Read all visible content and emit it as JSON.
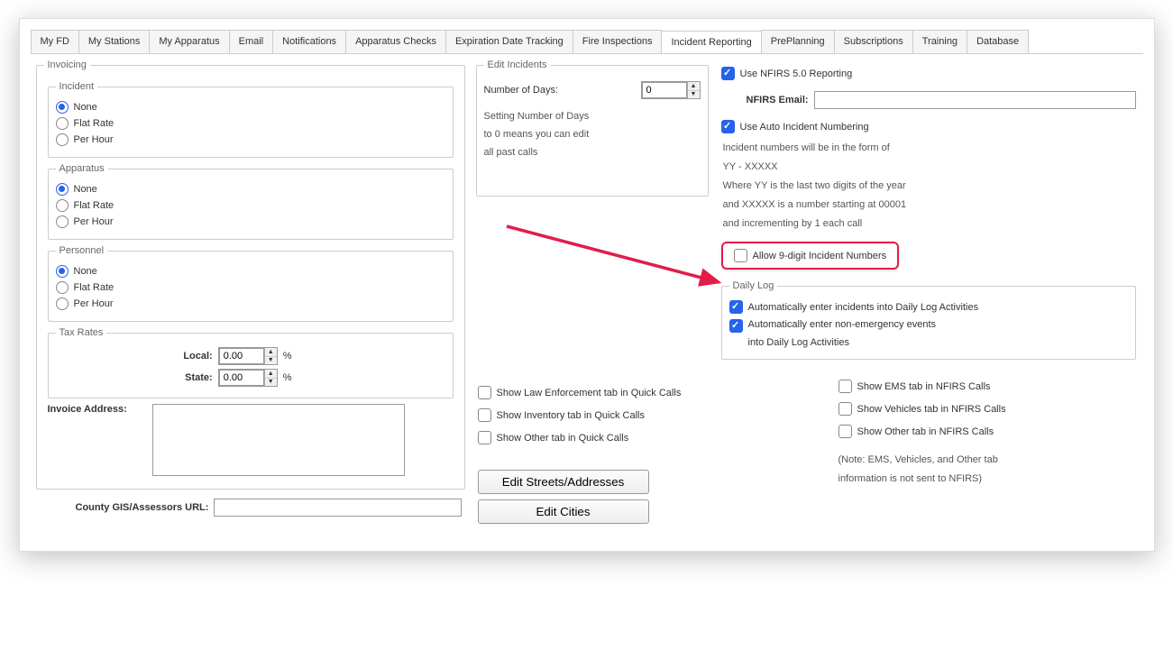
{
  "tabs": {
    "items": [
      "My FD",
      "My Stations",
      "My Apparatus",
      "Email",
      "Notifications",
      "Apparatus Checks",
      "Expiration Date Tracking",
      "Fire Inspections",
      "Incident Reporting",
      "PrePlanning",
      "Subscriptions",
      "Training",
      "Database"
    ],
    "active": "Incident Reporting"
  },
  "invoicing": {
    "legend": "Invoicing",
    "incident": {
      "legend": "Incident",
      "options": [
        "None",
        "Flat Rate",
        "Per Hour"
      ],
      "selected": "None"
    },
    "apparatus": {
      "legend": "Apparatus",
      "options": [
        "None",
        "Flat Rate",
        "Per Hour"
      ],
      "selected": "None"
    },
    "personnel": {
      "legend": "Personnel",
      "options": [
        "None",
        "Flat Rate",
        "Per Hour"
      ],
      "selected": "None"
    },
    "tax_rates": {
      "legend": "Tax Rates",
      "local_label": "Local:",
      "state_label": "State:",
      "local_value": "0.00",
      "state_value": "0.00",
      "unit": "%"
    },
    "invoice_address_label": "Invoice Address:",
    "invoice_address_value": ""
  },
  "county_gis": {
    "label": "County GIS/Assessors URL:",
    "value": ""
  },
  "edit_incidents": {
    "legend": "Edit Incidents",
    "days_label": "Number of Days:",
    "days_value": "0",
    "help_l1": "Setting Number of Days",
    "help_l2": "to 0 means you can edit",
    "help_l3": "all past calls"
  },
  "quick_calls": {
    "law_label": "Show Law Enforcement tab in Quick Calls",
    "inv_label": "Show Inventory tab in Quick Calls",
    "other_label": "Show Other tab in Quick Calls",
    "law_checked": false,
    "inv_checked": false,
    "other_checked": false
  },
  "edit_buttons": {
    "streets": "Edit Streets/Addresses",
    "cities": "Edit Cities"
  },
  "nfirs": {
    "use_50_label": "Use NFIRS 5.0 Reporting",
    "use_50_checked": true,
    "email_label": "NFIRS Email:",
    "email_value": "",
    "auto_num_label": "Use Auto Incident Numbering",
    "auto_num_checked": true,
    "fmt_l1": "Incident numbers will be in the form of",
    "fmt_l2": "YY - XXXXX",
    "fmt_l3": "Where YY is the last two digits of the year",
    "fmt_l4": "and XXXXX is a number starting at 00001",
    "fmt_l5": "and incrementing by 1 each call",
    "allow9_label": "Allow 9-digit Incident Numbers",
    "allow9_checked": false
  },
  "daily_log": {
    "legend": "Daily Log",
    "auto_incidents_label": "Automatically enter incidents into Daily Log Activities",
    "auto_incidents_checked": true,
    "auto_nonemerg_label": "Automatically enter non-emergency events",
    "auto_nonemerg_l2": "into Daily Log Activities",
    "auto_nonemerg_checked": true
  },
  "nfirs_calls": {
    "ems_label": "Show EMS tab in NFIRS Calls",
    "veh_label": "Show Vehicles tab in NFIRS Calls",
    "other_label": "Show Other tab in NFIRS Calls",
    "ems_checked": false,
    "veh_checked": false,
    "other_checked": false,
    "note_l1": "(Note:  EMS, Vehicles, and Other tab",
    "note_l2": "information is not sent to NFIRS)"
  }
}
